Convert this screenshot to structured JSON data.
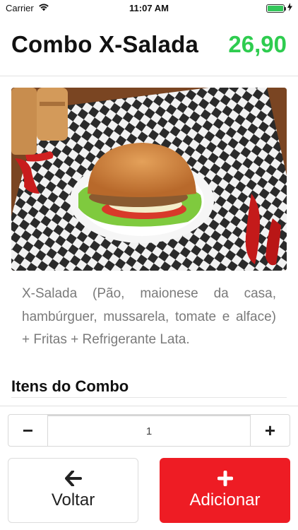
{
  "status_bar": {
    "carrier": "Carrier",
    "time": "11:07 AM",
    "battery_level": 1.0,
    "battery_color": "#33c75a"
  },
  "header": {
    "title": "Combo X-Salada",
    "price": "26,90",
    "price_color": "#2ecc4f"
  },
  "product": {
    "description": "X-Salada (Pão, maionese da casa, hambúrguer, mussarela, tomate e alface) + Fritas + Refrigerante Lata."
  },
  "combo_section": {
    "title": "Itens do Combo"
  },
  "quantity": {
    "minus_label": "−",
    "value": "1",
    "plus_label": "+"
  },
  "actions": {
    "back_label": "Voltar",
    "back_icon": "arrow-left-icon",
    "add_label": "Adicionar",
    "add_icon": "plus-icon",
    "add_color": "#ee1c24"
  }
}
